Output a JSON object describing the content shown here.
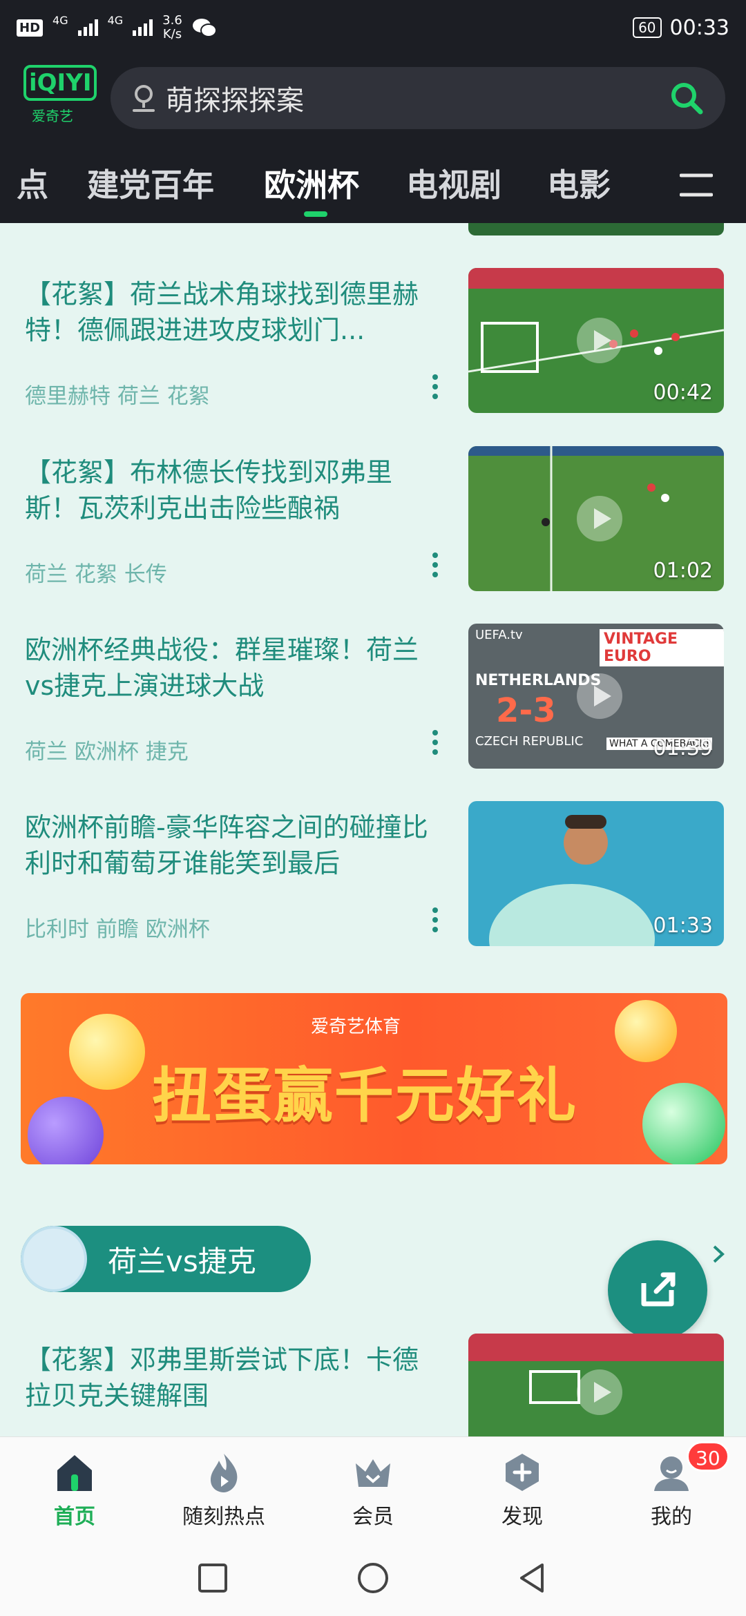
{
  "status_bar": {
    "hd": "HD",
    "network1": "4G",
    "network2": "4G",
    "speed_value": "3.6",
    "speed_unit": "K/s",
    "battery": "60",
    "time": "00:33"
  },
  "header": {
    "logo_text": "iQIYI",
    "logo_sub": "爱奇艺",
    "search_query": "萌探探探案",
    "tabs": [
      {
        "label": "点"
      },
      {
        "label": "建党百年"
      },
      {
        "label": "欧洲杯"
      },
      {
        "label": "电视剧"
      },
      {
        "label": "电影"
      }
    ],
    "active_tab": "欧洲杯"
  },
  "feed": {
    "items": [
      {
        "title": "【花絮】荷兰战术角球找到德里赫特！德佩跟进进攻皮球划门...",
        "tags": "德里赫特 荷兰 花絮",
        "duration": "00:42"
      },
      {
        "title": "【花絮】布林德长传找到邓弗里斯！瓦茨利克出击险些酿祸",
        "tags": "荷兰 花絮 长传",
        "duration": "01:02"
      },
      {
        "title": "欧洲杯经典战役：群星璀璨！荷兰vs捷克上演进球大战",
        "tags": "荷兰 欧洲杯 捷克",
        "duration": "01:39",
        "thumb_text": {
          "source": "UEFA.tv",
          "badge": "VINTAGE EURO",
          "team1": "NETHERLANDS",
          "score": "2-3",
          "team2": "CZECH REPUBLIC",
          "caption": "WHAT A COMEBACK!"
        }
      },
      {
        "title": "欧洲杯前瞻-豪华阵容之间的碰撞比利时和葡萄牙谁能笑到最后",
        "tags": "比利时 前瞻 欧洲杯",
        "duration": "01:33"
      }
    ],
    "banner": {
      "brand": "爱奇艺体育",
      "slogan": "扭蛋赢千元好礼"
    },
    "section": {
      "label": "荷兰vs捷克"
    },
    "next_item": {
      "title": "【花絮】邓弗里斯尝试下底！卡德拉贝克关键解围"
    }
  },
  "bottom_nav": {
    "items": [
      {
        "label": "首页",
        "icon": "home-icon"
      },
      {
        "label": "随刻热点",
        "icon": "flame-icon"
      },
      {
        "label": "会员",
        "icon": "crown-icon"
      },
      {
        "label": "发现",
        "icon": "discover-icon"
      },
      {
        "label": "我的",
        "icon": "profile-icon"
      }
    ],
    "profile_badge": "30"
  },
  "colors": {
    "brand_green": "#1fd26b",
    "teal_text": "#1f8c7c",
    "header_bg": "#1c1e24",
    "feed_bg": "#e6f5f1"
  }
}
